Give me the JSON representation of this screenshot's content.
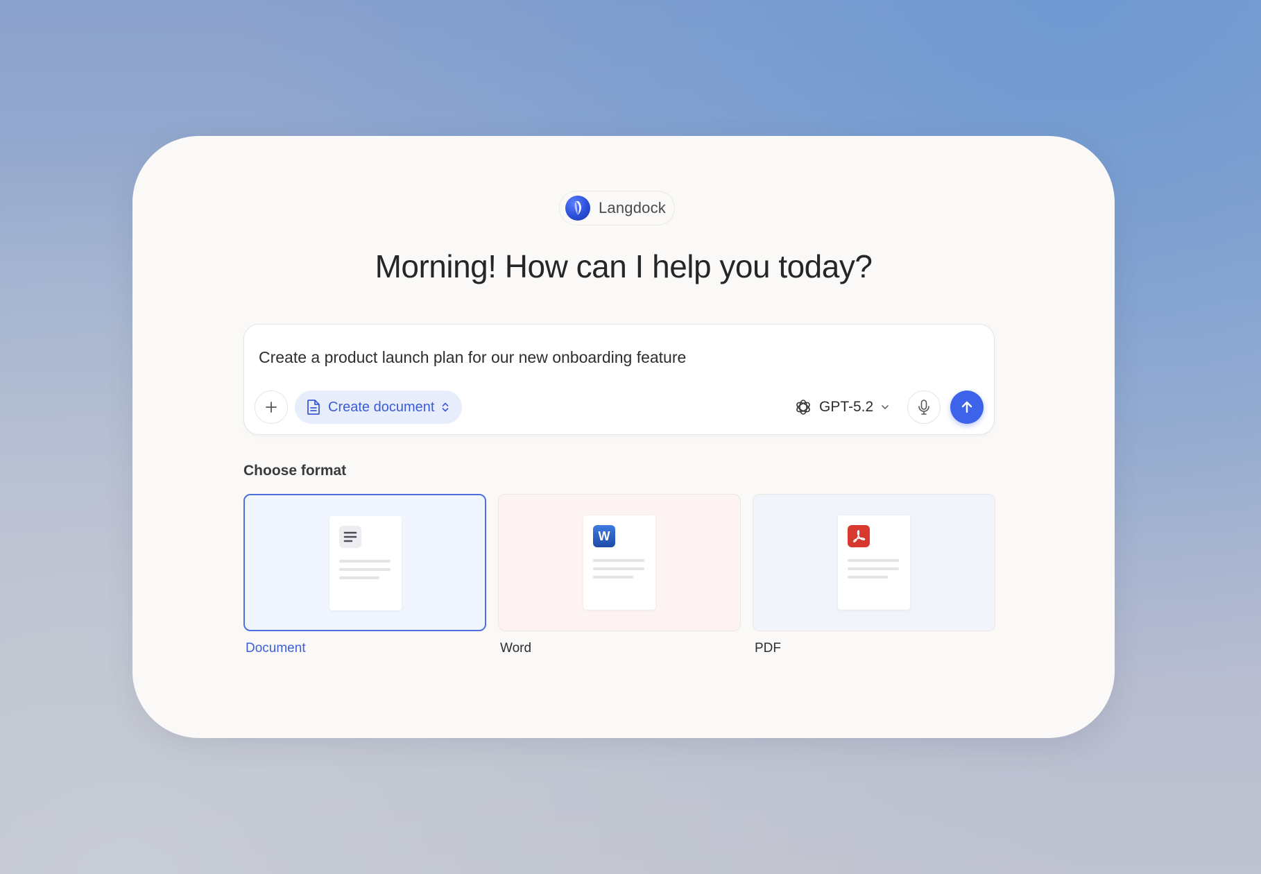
{
  "brand": {
    "name": "Langdock",
    "logo_color": "#2b4ed8"
  },
  "greeting": "Morning! How can I help you today?",
  "composer": {
    "prompt": "Create a product launch plan for our new onboarding feature",
    "add_icon": "plus-icon",
    "mode": {
      "label": "Create document",
      "icon": "document-icon",
      "accent": "#3a5bd6"
    },
    "model": {
      "label": "GPT-5.2",
      "icon": "openai-icon"
    },
    "mic_icon": "microphone-icon",
    "send_icon": "arrow-up-icon",
    "send_color": "#3d63ea"
  },
  "formats": {
    "title": "Choose format",
    "selected": "Document",
    "items": [
      {
        "label": "Document",
        "icon": "lines-icon",
        "selected": true
      },
      {
        "label": "Word",
        "icon": "word-icon",
        "badge_text": "W",
        "badge_color": "#2b5bb8"
      },
      {
        "label": "PDF",
        "icon": "pdf-icon",
        "badge_color": "#d63a2f"
      }
    ]
  }
}
